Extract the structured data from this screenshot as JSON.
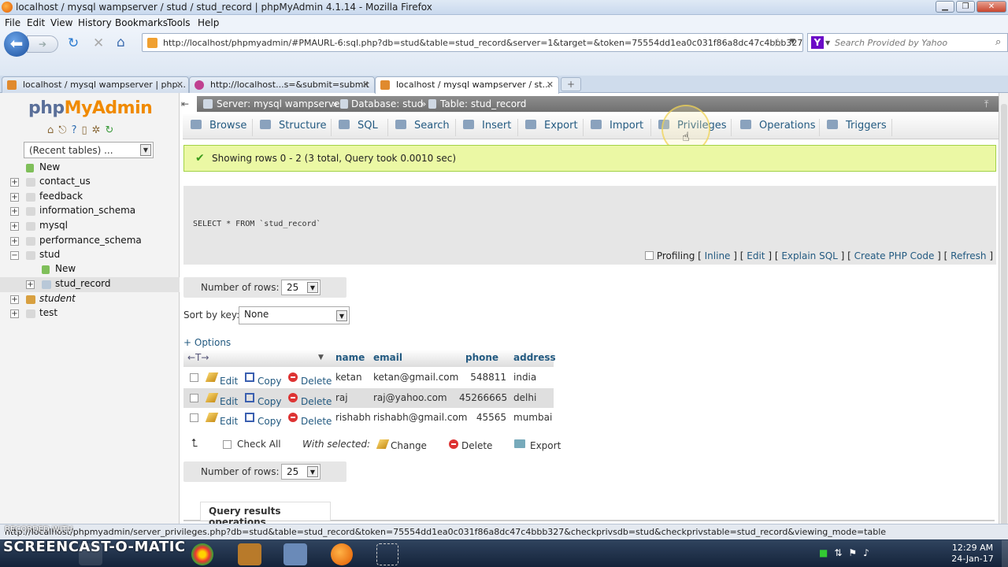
{
  "window": {
    "title": "localhost / mysql wampserver / stud / stud_record | phpMyAdmin 4.1.14 - Mozilla Firefox"
  },
  "menu": [
    "File",
    "Edit",
    "View",
    "History",
    "Bookmarks",
    "Tools",
    "Help"
  ],
  "browser": {
    "url": "http://localhost/phpmyadmin/#PMAURL-6:sql.php?db=stud&table=stud_record&server=1&target=&token=75554dd1ea0c031f86a8dc47c4bbb327",
    "search_placeholder": "Search Provided by Yahoo",
    "tabs": [
      {
        "label": "localhost / mysql wampserver | php..."
      },
      {
        "label": "http://localhost...s=&submit=submit"
      },
      {
        "label": "localhost / mysql wampserver / st..."
      }
    ]
  },
  "sidebar": {
    "logo_php": "php",
    "logo_my": "MyAdmin",
    "recent": "(Recent tables) ...",
    "tree": [
      "New",
      "contact_us",
      "feedback",
      "information_schema",
      "mysql",
      "performance_schema",
      "stud",
      "New",
      "stud_record",
      "student",
      "test"
    ]
  },
  "breadcrumb": {
    "server": "Server: mysql wampserver",
    "database": "Database: stud",
    "table": "Table: stud_record"
  },
  "pma_tabs": [
    "Browse",
    "Structure",
    "SQL",
    "Search",
    "Insert",
    "Export",
    "Import",
    "Privileges",
    "Operations",
    "Triggers"
  ],
  "success": "Showing rows 0 - 2 (3 total, Query took 0.0010 sec)",
  "sql": {
    "query": "SELECT * FROM `stud_record`",
    "profiling": "Profiling",
    "links": [
      "Inline",
      "Edit",
      "Explain SQL",
      "Create PHP Code",
      "Refresh"
    ]
  },
  "rows_label": "Number of rows:",
  "rows_value": "25",
  "sort_label": "Sort by key:",
  "sort_value": "None",
  "options": "+ Options",
  "columns": [
    "name",
    "email",
    "phone",
    "address"
  ],
  "row_actions": {
    "edit": "Edit",
    "copy": "Copy",
    "delete": "Delete"
  },
  "rows": [
    {
      "name": "ketan",
      "email": "ketan@gmail.com",
      "phone": "548811",
      "address": "india"
    },
    {
      "name": "raj",
      "email": "raj@yahoo.com",
      "phone": "45266665",
      "address": "delhi"
    },
    {
      "name": "rishabh",
      "email": "rishabh@gmail.com",
      "phone": "45565",
      "address": "mumbai"
    }
  ],
  "with_selected": {
    "check_all": "Check All",
    "label": "With selected:",
    "change": "Change",
    "delete": "Delete",
    "export": "Export"
  },
  "qro": "Query results operations",
  "status_url": "http://localhost/phpmyadmin/server_privileges.php?db=stud&table=stud_record&token=75554dd1ea0c031f86a8dc47c4bbb327&checkprivsdb=stud&checkprivstable=stud_record&viewing_mode=table",
  "watermark": {
    "top": "RECORDED WITH",
    "main": "SCREENCAST-O-MATIC"
  },
  "clock": {
    "time": "12:29 AM",
    "date": "24-Jan-17"
  }
}
